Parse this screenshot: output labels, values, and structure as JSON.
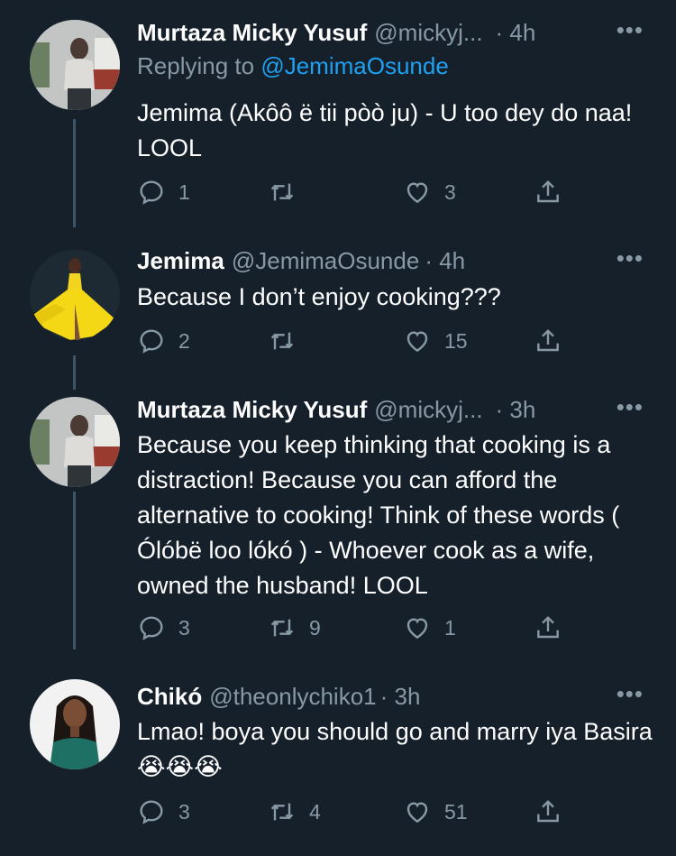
{
  "tweets": [
    {
      "name": "Murtaza Micky Yusuf",
      "handle": "@mickyj...",
      "time": "· 4h",
      "replying_label": "Replying to ",
      "replying_handle": "@JemimaOsunde",
      "text": "Jemima (Akôô ë tii pòò  ju) - U too dey do naa! LOOL",
      "replies": "1",
      "retweets": "",
      "likes": "3"
    },
    {
      "name": "Jemima",
      "handle": "@JemimaOsunde",
      "time": "· 4h",
      "text": "Because I don’t enjoy cooking???",
      "replies": "2",
      "retweets": "",
      "likes": "15"
    },
    {
      "name": "Murtaza Micky Yusuf",
      "handle": "@mickyj...",
      "time": "· 3h",
      "text": "Because you keep thinking that cooking is a distraction! Because you can afford the alternative to cooking! Think of these words ( Ólóbë loo lókó ) - Whoever cook as a wife, owned the husband! LOOL",
      "replies": "3",
      "retweets": "9",
      "likes": "1"
    },
    {
      "name": "Chikó",
      "handle": "@theonlychiko1",
      "time": "· 3h",
      "text": "Lmao! boya you should go and marry iya Basira 😭😭😭",
      "replies": "3",
      "retweets": "4",
      "likes": "51"
    }
  ],
  "more_glyph": "•••",
  "colors": {
    "background": "#15202b",
    "text": "#ffffff",
    "muted": "#8899a6",
    "link": "#1da1f2"
  },
  "icons": [
    "reply-icon",
    "retweet-icon",
    "like-icon",
    "share-icon",
    "more-icon"
  ]
}
